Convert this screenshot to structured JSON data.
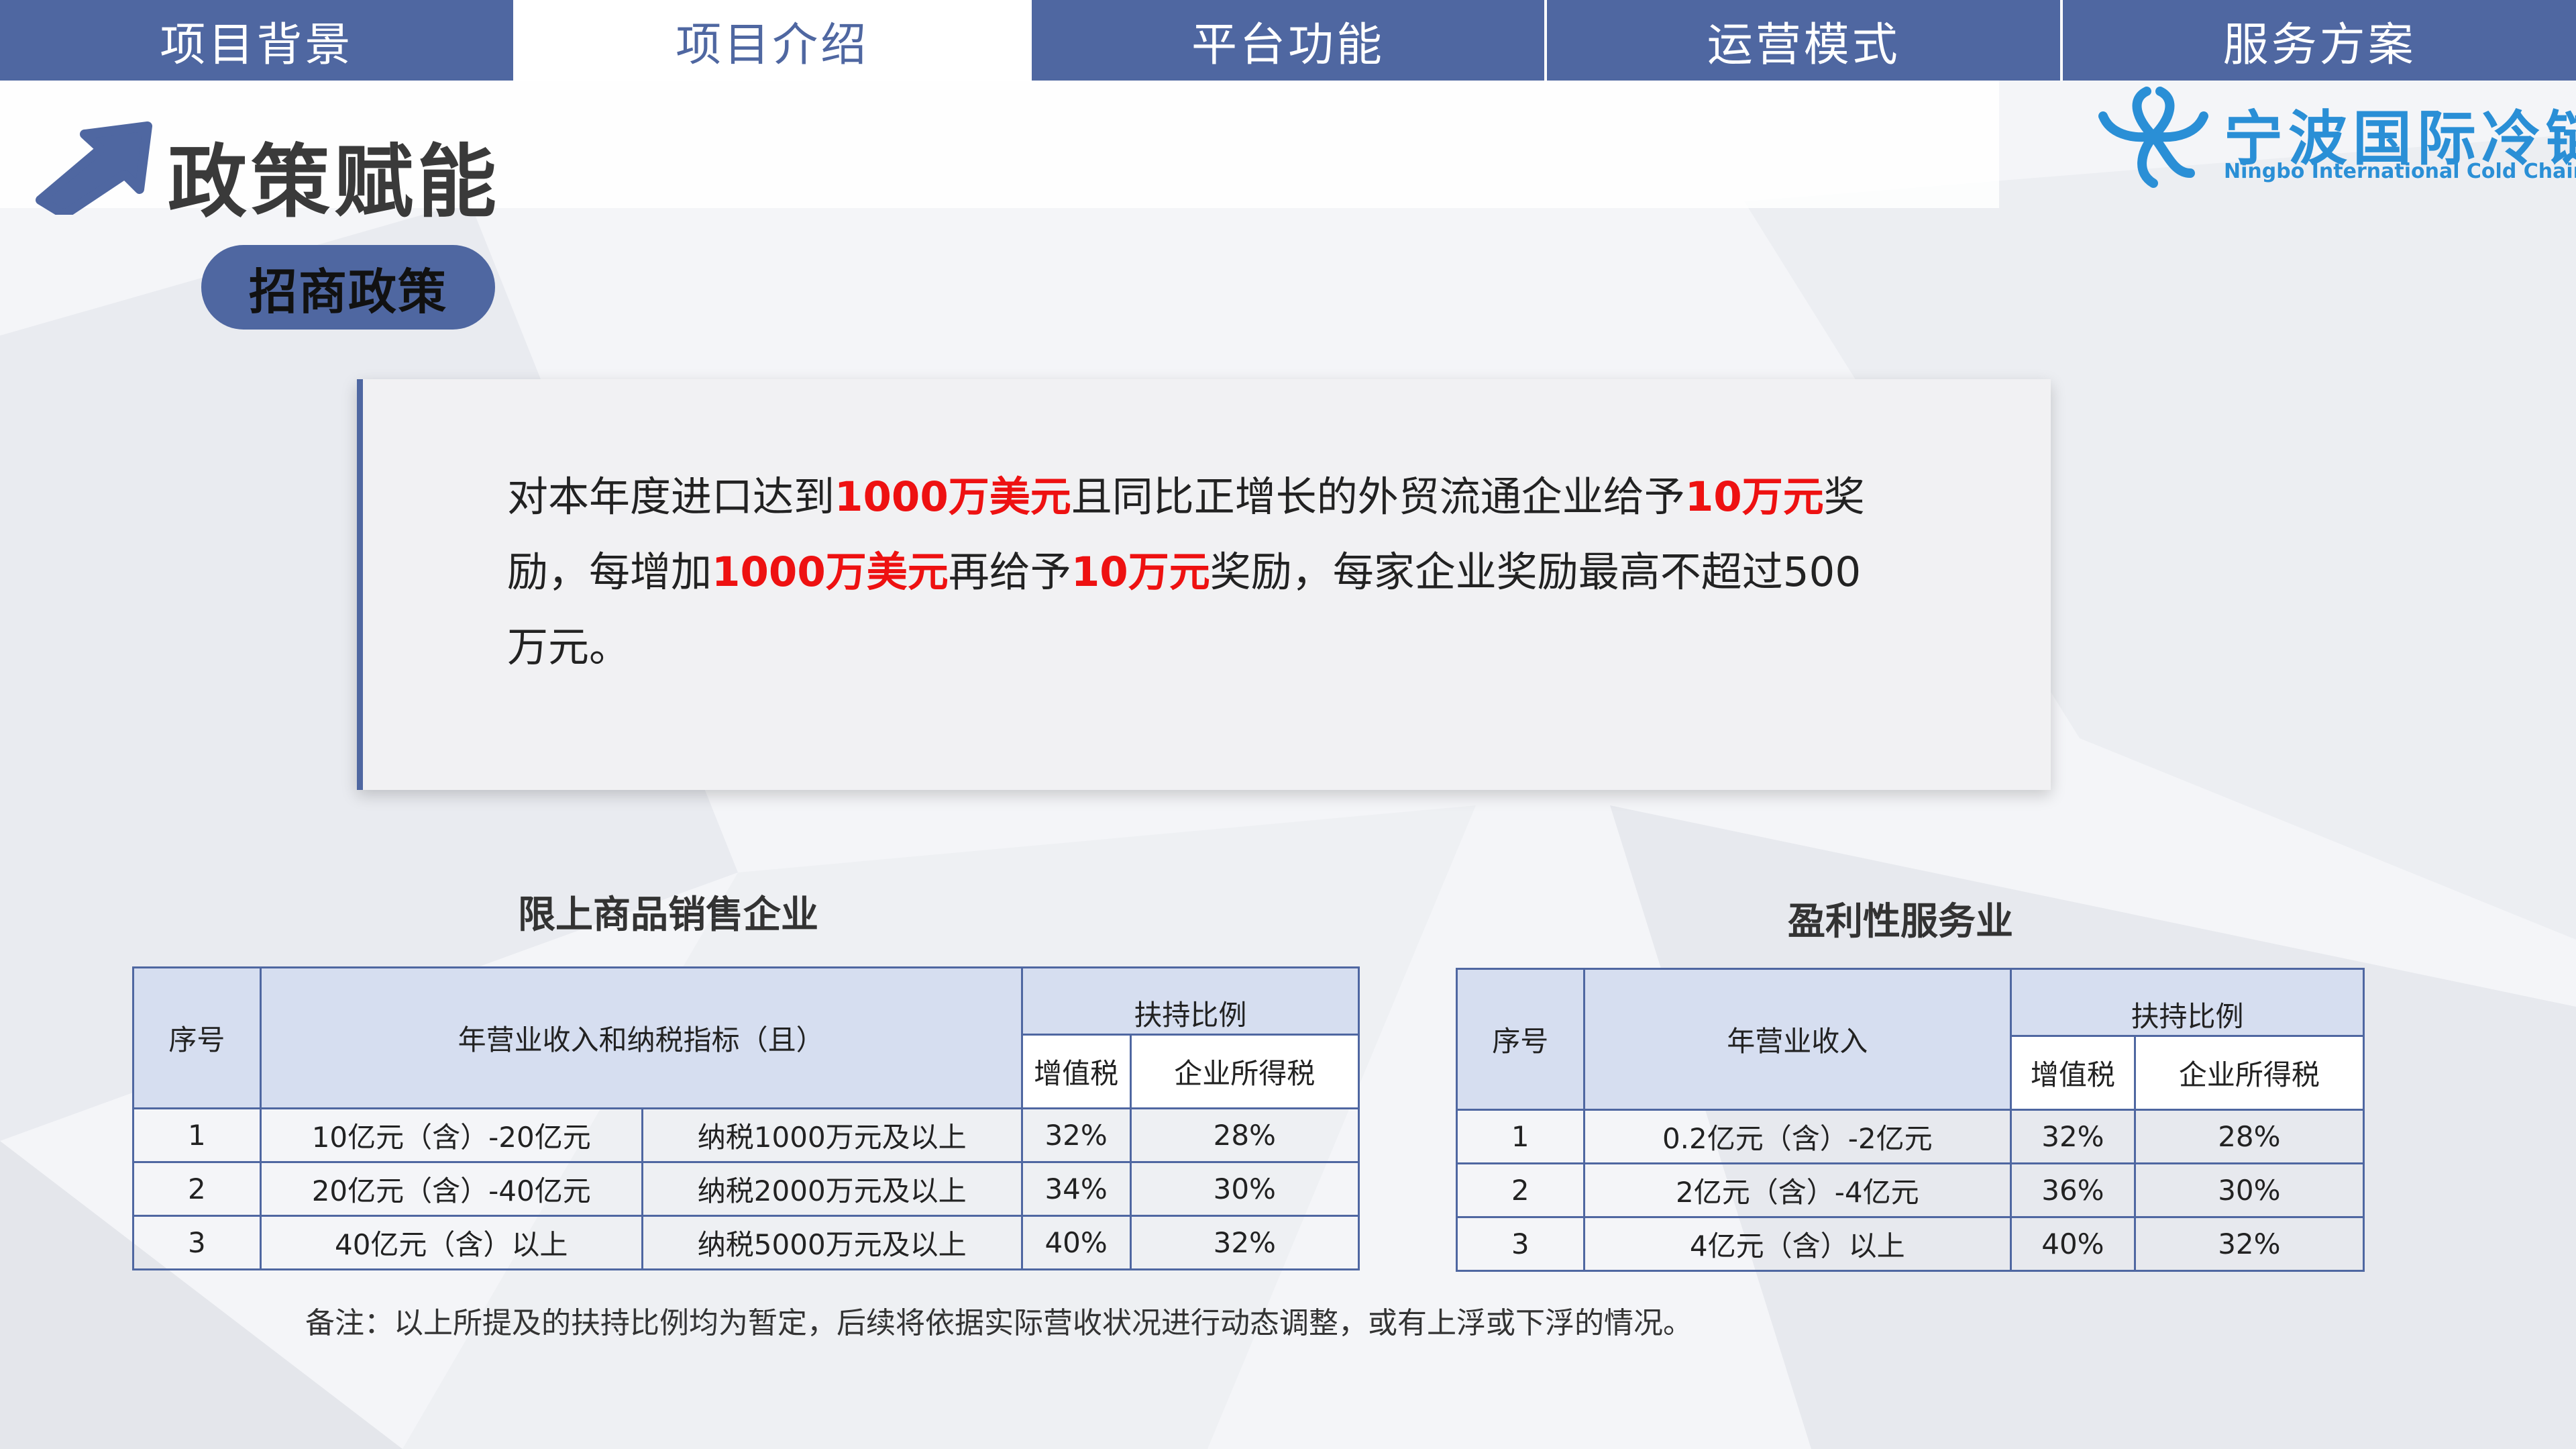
{
  "nav": [
    {
      "label": "项目背景"
    },
    {
      "label": "项目介绍"
    },
    {
      "label": "平台功能"
    },
    {
      "label": "运营模式"
    },
    {
      "label": "服务方案"
    }
  ],
  "page_title": "政策赋能",
  "logo": {
    "cn": "宁波国际冷链",
    "en": "Ningbo International Cold Chain"
  },
  "section_pill": "招商政策",
  "policy": {
    "p1": "对本年度进口达到",
    "h1": "1000万美元",
    "p2": "且同比正增长的外贸流通企业给予",
    "h2": "10万元",
    "p3": "奖励，每增加",
    "h3": "1000万美元",
    "p4": "再给予",
    "h4": "10万元",
    "p5": "奖励，每家企业奖励最高不超过500万元。"
  },
  "table1": {
    "title": "限上商品销售企业",
    "h_no": "序号",
    "h_indicator": "年营业收入和纳税指标（且）",
    "h_support": "扶持比例",
    "h_vat": "增值税",
    "h_cit": "企业所得税",
    "rows": [
      {
        "no": "1",
        "revenue": "10亿元（含）-20亿元",
        "tax": "纳税1000万元及以上",
        "vat": "32%",
        "cit": "28%"
      },
      {
        "no": "2",
        "revenue": "20亿元（含）-40亿元",
        "tax": "纳税2000万元及以上",
        "vat": "34%",
        "cit": "30%"
      },
      {
        "no": "3",
        "revenue": "40亿元（含）以上",
        "tax": "纳税5000万元及以上",
        "vat": "40%",
        "cit": "32%"
      }
    ]
  },
  "table2": {
    "title": "盈利性服务业",
    "h_no": "序号",
    "h_revenue": "年营业收入",
    "h_support": "扶持比例",
    "h_vat": "增值税",
    "h_cit": "企业所得税",
    "rows": [
      {
        "no": "1",
        "revenue": "0.2亿元（含）-2亿元",
        "vat": "32%",
        "cit": "28%"
      },
      {
        "no": "2",
        "revenue": "2亿元（含）-4亿元",
        "vat": "36%",
        "cit": "30%"
      },
      {
        "no": "3",
        "revenue": "4亿元（含）以上",
        "vat": "40%",
        "cit": "32%"
      }
    ]
  },
  "note": "备注：以上所提及的扶持比例均为暂定，后续将依据实际营收状况进行动态调整，或有上浮或下浮的情况。",
  "colors": {
    "accent": "#4f67a1",
    "highlight": "#ee1111",
    "logo": "#2a8fd6"
  }
}
